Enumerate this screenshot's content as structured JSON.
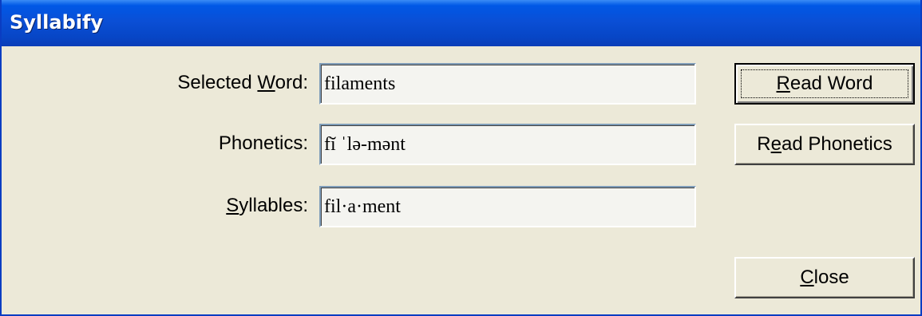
{
  "window": {
    "title": "Syllabify"
  },
  "fields": {
    "selected_word": {
      "label_before": "Selected ",
      "label_mnemonic": "W",
      "label_after": "ord:",
      "value": "filaments"
    },
    "phonetics": {
      "label": "Phonetics:",
      "value": "fĭ ˈlə-mənt"
    },
    "syllables": {
      "label_mnemonic": "S",
      "label_after": "yllables:",
      "value": "fil·a·ment"
    }
  },
  "buttons": {
    "read_word": {
      "mnemonic": "R",
      "rest": "ead Word"
    },
    "read_phonetics": {
      "before": "R",
      "mnemonic": "e",
      "rest": "ad Phonetics"
    },
    "close": {
      "mnemonic": "C",
      "rest": "lose"
    }
  },
  "colors": {
    "titlebar": "#0A4FD6",
    "dialog_bg": "#ECE9D8",
    "field_bg": "#F4F4F0"
  }
}
